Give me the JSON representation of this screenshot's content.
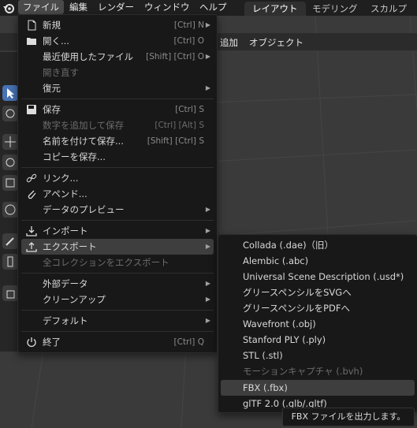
{
  "topbar": {
    "menus": [
      "ファイル",
      "編集",
      "レンダー",
      "ウィンドウ",
      "ヘルプ"
    ],
    "workspaces": [
      "レイアウト",
      "モデリング",
      "スカルプト"
    ]
  },
  "viewport": {
    "menus": [
      "追加",
      "オブジェクト"
    ]
  },
  "file_menu": {
    "items": [
      {
        "label": "新規",
        "shortcut": "[Ctrl] N",
        "icon": "new-file-icon",
        "submenu": true
      },
      {
        "label": "開く...",
        "shortcut": "[Ctrl] O",
        "icon": "folder-icon"
      },
      {
        "label": "最近使用したファイル",
        "shortcut": "[Shift] [Ctrl] O",
        "submenu": true
      },
      {
        "label": "開き直す",
        "disabled": true
      },
      {
        "label": "復元",
        "submenu": true
      },
      {
        "label": "保存",
        "shortcut": "[Ctrl] S",
        "icon": "save-icon"
      },
      {
        "label": "数字を追加して保存",
        "shortcut": "[Ctrl] [Alt] S",
        "disabled": true
      },
      {
        "label": "名前を付けて保存...",
        "shortcut": "[Shift] [Ctrl] S"
      },
      {
        "label": "コピーを保存..."
      },
      {
        "label": "リンク...",
        "icon": "link-icon"
      },
      {
        "label": "アペンド...",
        "icon": "append-icon"
      },
      {
        "label": "データのプレビュー",
        "submenu": true
      },
      {
        "label": "インポート",
        "icon": "import-icon",
        "submenu": true
      },
      {
        "label": "エクスポート",
        "icon": "export-icon",
        "submenu": true
      },
      {
        "label": "全コレクションをエクスポート",
        "disabled": true
      },
      {
        "label": "外部データ",
        "submenu": true
      },
      {
        "label": "クリーンアップ",
        "submenu": true
      },
      {
        "label": "デフォルト",
        "submenu": true
      },
      {
        "label": "終了",
        "shortcut": "[Ctrl] Q",
        "icon": "power-icon"
      }
    ]
  },
  "export_menu": {
    "items": [
      {
        "label": "Collada (.dae)（旧）"
      },
      {
        "label": "Alembic (.abc)"
      },
      {
        "label": "Universal Scene Description (.usd*)"
      },
      {
        "label": "グリースペンシルをSVGへ"
      },
      {
        "label": "グリースペンシルをPDFへ"
      },
      {
        "label": "Wavefront (.obj)"
      },
      {
        "label": "Stanford PLY (.ply)"
      },
      {
        "label": "STL (.stl)"
      },
      {
        "label": "モーションキャプチャ (.bvh)",
        "disabled": true
      },
      {
        "label": "FBX (.fbx)"
      },
      {
        "label": "glTF 2.0 (.glb/.gltf)"
      }
    ]
  },
  "tooltip": "FBX ファイルを出力します。",
  "colors": {
    "accent": "#4772b3",
    "menu_bg": "#181818",
    "highlight": "#3e3e3e"
  }
}
